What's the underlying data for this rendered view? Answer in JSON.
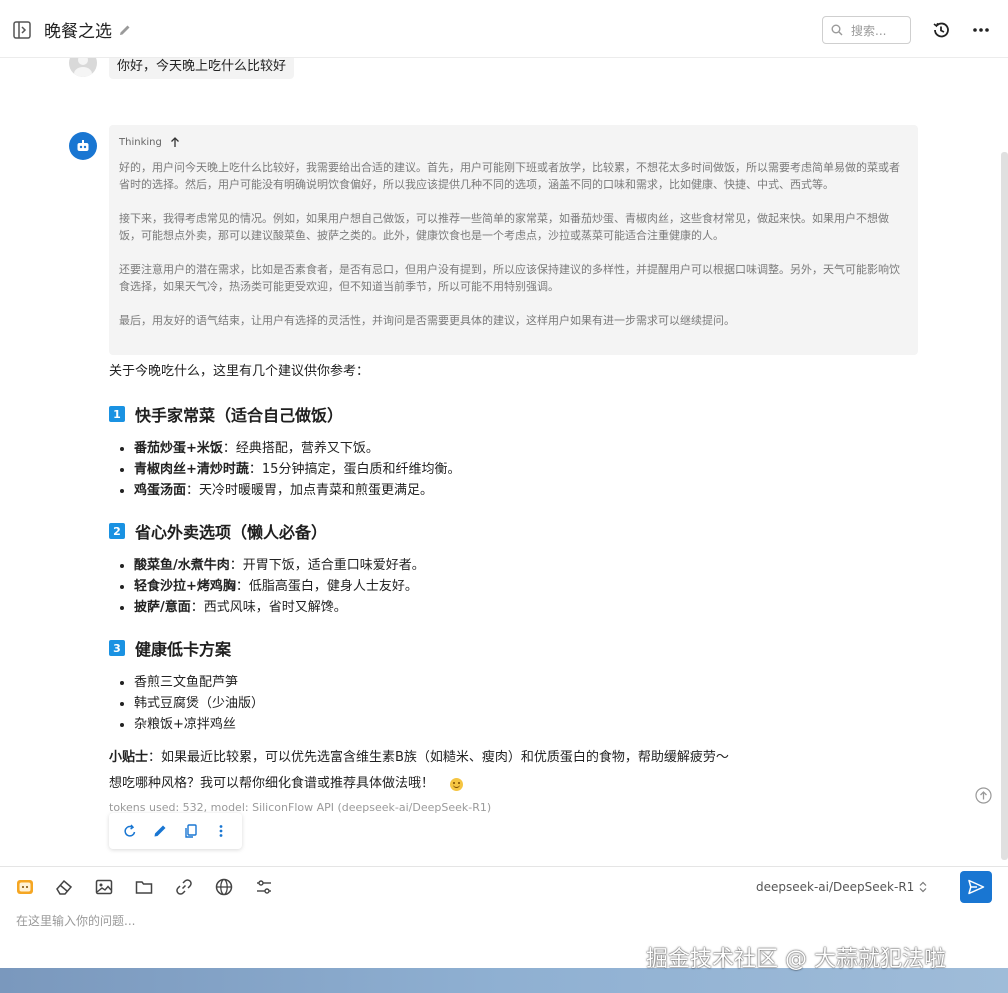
{
  "header": {
    "title": "晚餐之选",
    "search_placeholder": "搜索..."
  },
  "user_message": {
    "text": "你好，今天晚上吃什么比较好"
  },
  "thinking": {
    "label": "Thinking",
    "paragraphs": [
      "好的，用户问今天晚上吃什么比较好，我需要给出合适的建议。首先，用户可能刚下班或者放学，比较累，不想花太多时间做饭，所以需要考虑简单易做的菜或者省时的选择。然后，用户可能没有明确说明饮食偏好，所以我应该提供几种不同的选项，涵盖不同的口味和需求，比如健康、快捷、中式、西式等。",
      "接下来，我得考虑常见的情况。例如，如果用户想自己做饭，可以推荐一些简单的家常菜，如番茄炒蛋、青椒肉丝，这些食材常见，做起来快。如果用户不想做饭，可能想点外卖，那可以建议酸菜鱼、披萨之类的。此外，健康饮食也是一个考虑点，沙拉或蒸菜可能适合注重健康的人。",
      "还要注意用户的潜在需求，比如是否素食者，是否有忌口，但用户没有提到，所以应该保持建议的多样性，并提醒用户可以根据口味调整。另外，天气可能影响饮食选择，如果天气冷，热汤类可能更受欢迎，但不知道当前季节，所以可能不用特别强调。",
      "最后，用友好的语气结束，让用户有选择的灵活性，并询问是否需要更具体的建议，这样用户如果有进一步需求可以继续提问。"
    ]
  },
  "answer": {
    "intro": "关于今晚吃什么，这里有几个建议供你参考：",
    "sections": [
      {
        "num": "1",
        "title": "快手家常菜（适合自己做饭）",
        "items": [
          {
            "bold": "番茄炒蛋+米饭",
            "rest": "：经典搭配，营养又下饭。"
          },
          {
            "bold": "青椒肉丝+清炒时蔬",
            "rest": "：15分钟搞定，蛋白质和纤维均衡。"
          },
          {
            "bold": "鸡蛋汤面",
            "rest": "：天冷时暖暖胃，加点青菜和煎蛋更满足。"
          }
        ]
      },
      {
        "num": "2",
        "title": "省心外卖选项（懒人必备）",
        "items": [
          {
            "bold": "酸菜鱼/水煮牛肉",
            "rest": "：开胃下饭，适合重口味爱好者。"
          },
          {
            "bold": "轻食沙拉+烤鸡胸",
            "rest": "：低脂高蛋白，健身人士友好。"
          },
          {
            "bold": "披萨/意面",
            "rest": "：西式风味，省时又解馋。"
          }
        ]
      },
      {
        "num": "3",
        "title": "健康低卡方案",
        "items": [
          {
            "bold": "",
            "rest": "香煎三文鱼配芦笋"
          },
          {
            "bold": "",
            "rest": "韩式豆腐煲（少油版）"
          },
          {
            "bold": "",
            "rest": "杂粮饭+凉拌鸡丝"
          }
        ]
      }
    ],
    "tip_label": "小贴士",
    "tip_text": "：如果最近比较累，可以优先选富含维生素B族（如糙米、瘦肉）和优质蛋白的食物，帮助缓解疲劳～",
    "closing": "想吃哪种风格？我可以帮你细化食谱或推荐具体做法哦！",
    "meta": "tokens used: 532, model: SiliconFlow API (deepseek-ai/DeepSeek-R1)"
  },
  "toolbar": {
    "model": "deepseek-ai/DeepSeek-R1"
  },
  "input": {
    "placeholder": "在这里输入你的问题..."
  },
  "watermark": "掘金技术社区 @ 大蒜就犯法啦",
  "colors": {
    "accent": "#1976d2",
    "badge": "#1a92e2",
    "thinking_bg": "#f4f4f4"
  }
}
